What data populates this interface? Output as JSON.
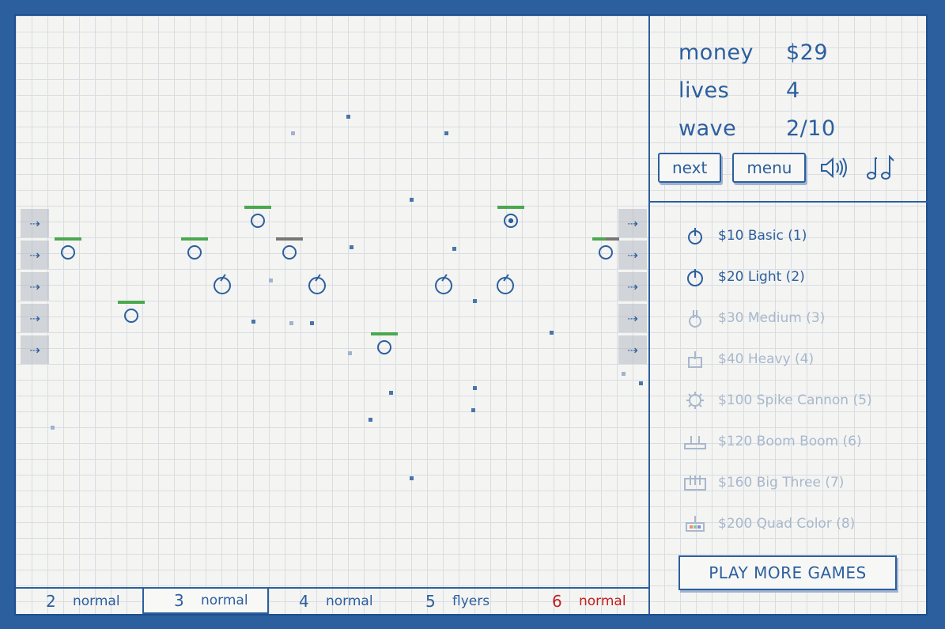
{
  "stats": {
    "money_label": "money",
    "money_value": "$29",
    "lives_label": "lives",
    "lives_value": "4",
    "wave_label": "wave",
    "wave_value": "2/10"
  },
  "controls": {
    "next_label": "next",
    "menu_label": "menu",
    "sound_icon": "speaker-icon",
    "music_icon": "music-notes-icon"
  },
  "towers": [
    {
      "label": "$10 Basic (1)",
      "icon": "basic-tower-icon",
      "locked": false
    },
    {
      "label": "$20 Light (2)",
      "icon": "light-tower-icon",
      "locked": false
    },
    {
      "label": "$30 Medium (3)",
      "icon": "medium-tower-icon",
      "locked": true
    },
    {
      "label": "$40 Heavy (4)",
      "icon": "heavy-tower-icon",
      "locked": true
    },
    {
      "label": "$100 Spike Cannon (5)",
      "icon": "spike-cannon-icon",
      "locked": true
    },
    {
      "label": "$120 Boom Boom (6)",
      "icon": "boom-boom-icon",
      "locked": true
    },
    {
      "label": "$160 Big Three (7)",
      "icon": "big-three-icon",
      "locked": true
    },
    {
      "label": "$200 Quad Color (8)",
      "icon": "quad-color-icon",
      "locked": true
    }
  ],
  "more_games_label": "PLAY MORE GAMES",
  "waves": [
    {
      "num": "2",
      "type": "normal",
      "current": false,
      "danger": false
    },
    {
      "num": "3",
      "type": "normal",
      "current": true,
      "danger": false
    },
    {
      "num": "4",
      "type": "normal",
      "current": false,
      "danger": false
    },
    {
      "num": "5",
      "type": "flyers",
      "current": false,
      "danger": false
    },
    {
      "num": "6",
      "type": "normal",
      "current": false,
      "danger": true
    }
  ],
  "colors": {
    "ink": "#2c5f9e",
    "health": "#4aa84f",
    "danger": "#c02020"
  }
}
